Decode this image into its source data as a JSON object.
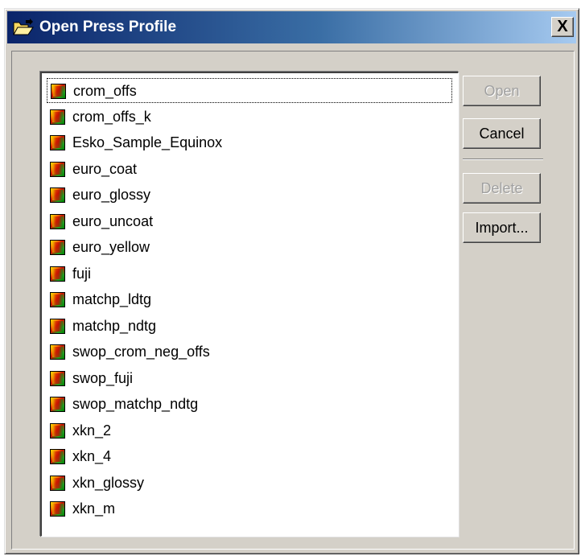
{
  "window": {
    "title": "Open Press Profile",
    "close_label": "X"
  },
  "profiles": [
    "crom_offs",
    "crom_offs_k",
    "Esko_Sample_Equinox",
    "euro_coat",
    "euro_glossy",
    "euro_uncoat",
    "euro_yellow",
    "fuji",
    "matchp_ldtg",
    "matchp_ndtg",
    "swop_crom_neg_offs",
    "swop_fuji",
    "swop_matchp_ndtg",
    "xkn_2",
    "xkn_4",
    "xkn_glossy",
    "xkn_m"
  ],
  "buttons": {
    "open": "Open",
    "cancel": "Cancel",
    "delete": "Delete",
    "import": "Import..."
  },
  "icons": {
    "title": "folder-open-icon",
    "item": "color-profile-icon"
  }
}
